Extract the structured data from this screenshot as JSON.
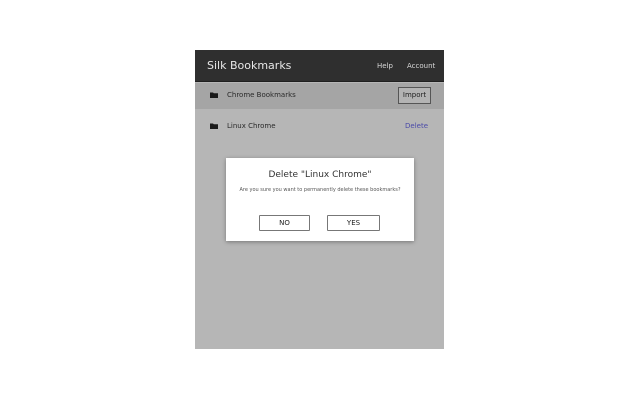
{
  "header": {
    "title": "Silk Bookmarks",
    "help": "Help",
    "account": "Account"
  },
  "bookmarks": [
    {
      "label": "Chrome Bookmarks",
      "action": "Import"
    },
    {
      "label": "Linux Chrome",
      "action": "Delete"
    }
  ],
  "dialog": {
    "title": "Delete \"Linux Chrome\"",
    "message": "Are you sure you want to permanently delete these bookmarks?",
    "no_label": "NO",
    "yes_label": "YES"
  },
  "colors": {
    "header_bg": "#2f2f2f",
    "overlay_bg": "#b6b6b6",
    "link": "#4a4aa8"
  },
  "icons": {
    "folder": "folder-icon"
  }
}
